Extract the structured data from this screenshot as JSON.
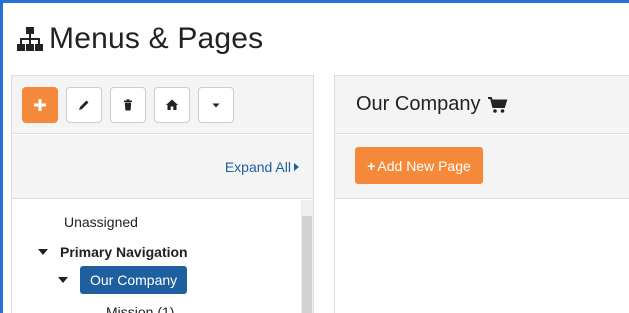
{
  "page": {
    "title": "Menus & Pages",
    "icon": "sitemap-icon"
  },
  "toolbar": {
    "buttons": [
      {
        "name": "add",
        "icon": "plus-icon",
        "color": "#f5893a"
      },
      {
        "name": "edit",
        "icon": "pencil-icon"
      },
      {
        "name": "delete",
        "icon": "trash-icon"
      },
      {
        "name": "home",
        "icon": "home-icon"
      },
      {
        "name": "more",
        "icon": "caret-down-icon"
      }
    ]
  },
  "expand": {
    "label": "Expand All"
  },
  "tree": {
    "items": [
      {
        "label": "Unassigned"
      },
      {
        "label": "Primary Navigation"
      },
      {
        "label": "Our Company"
      },
      {
        "label": "Mission (1)"
      }
    ]
  },
  "right": {
    "title": "Our Company",
    "title_icon": "cart-icon",
    "add_label": "Add New Page",
    "accent": "#f5893a",
    "selected_color": "#1e5fa0"
  }
}
